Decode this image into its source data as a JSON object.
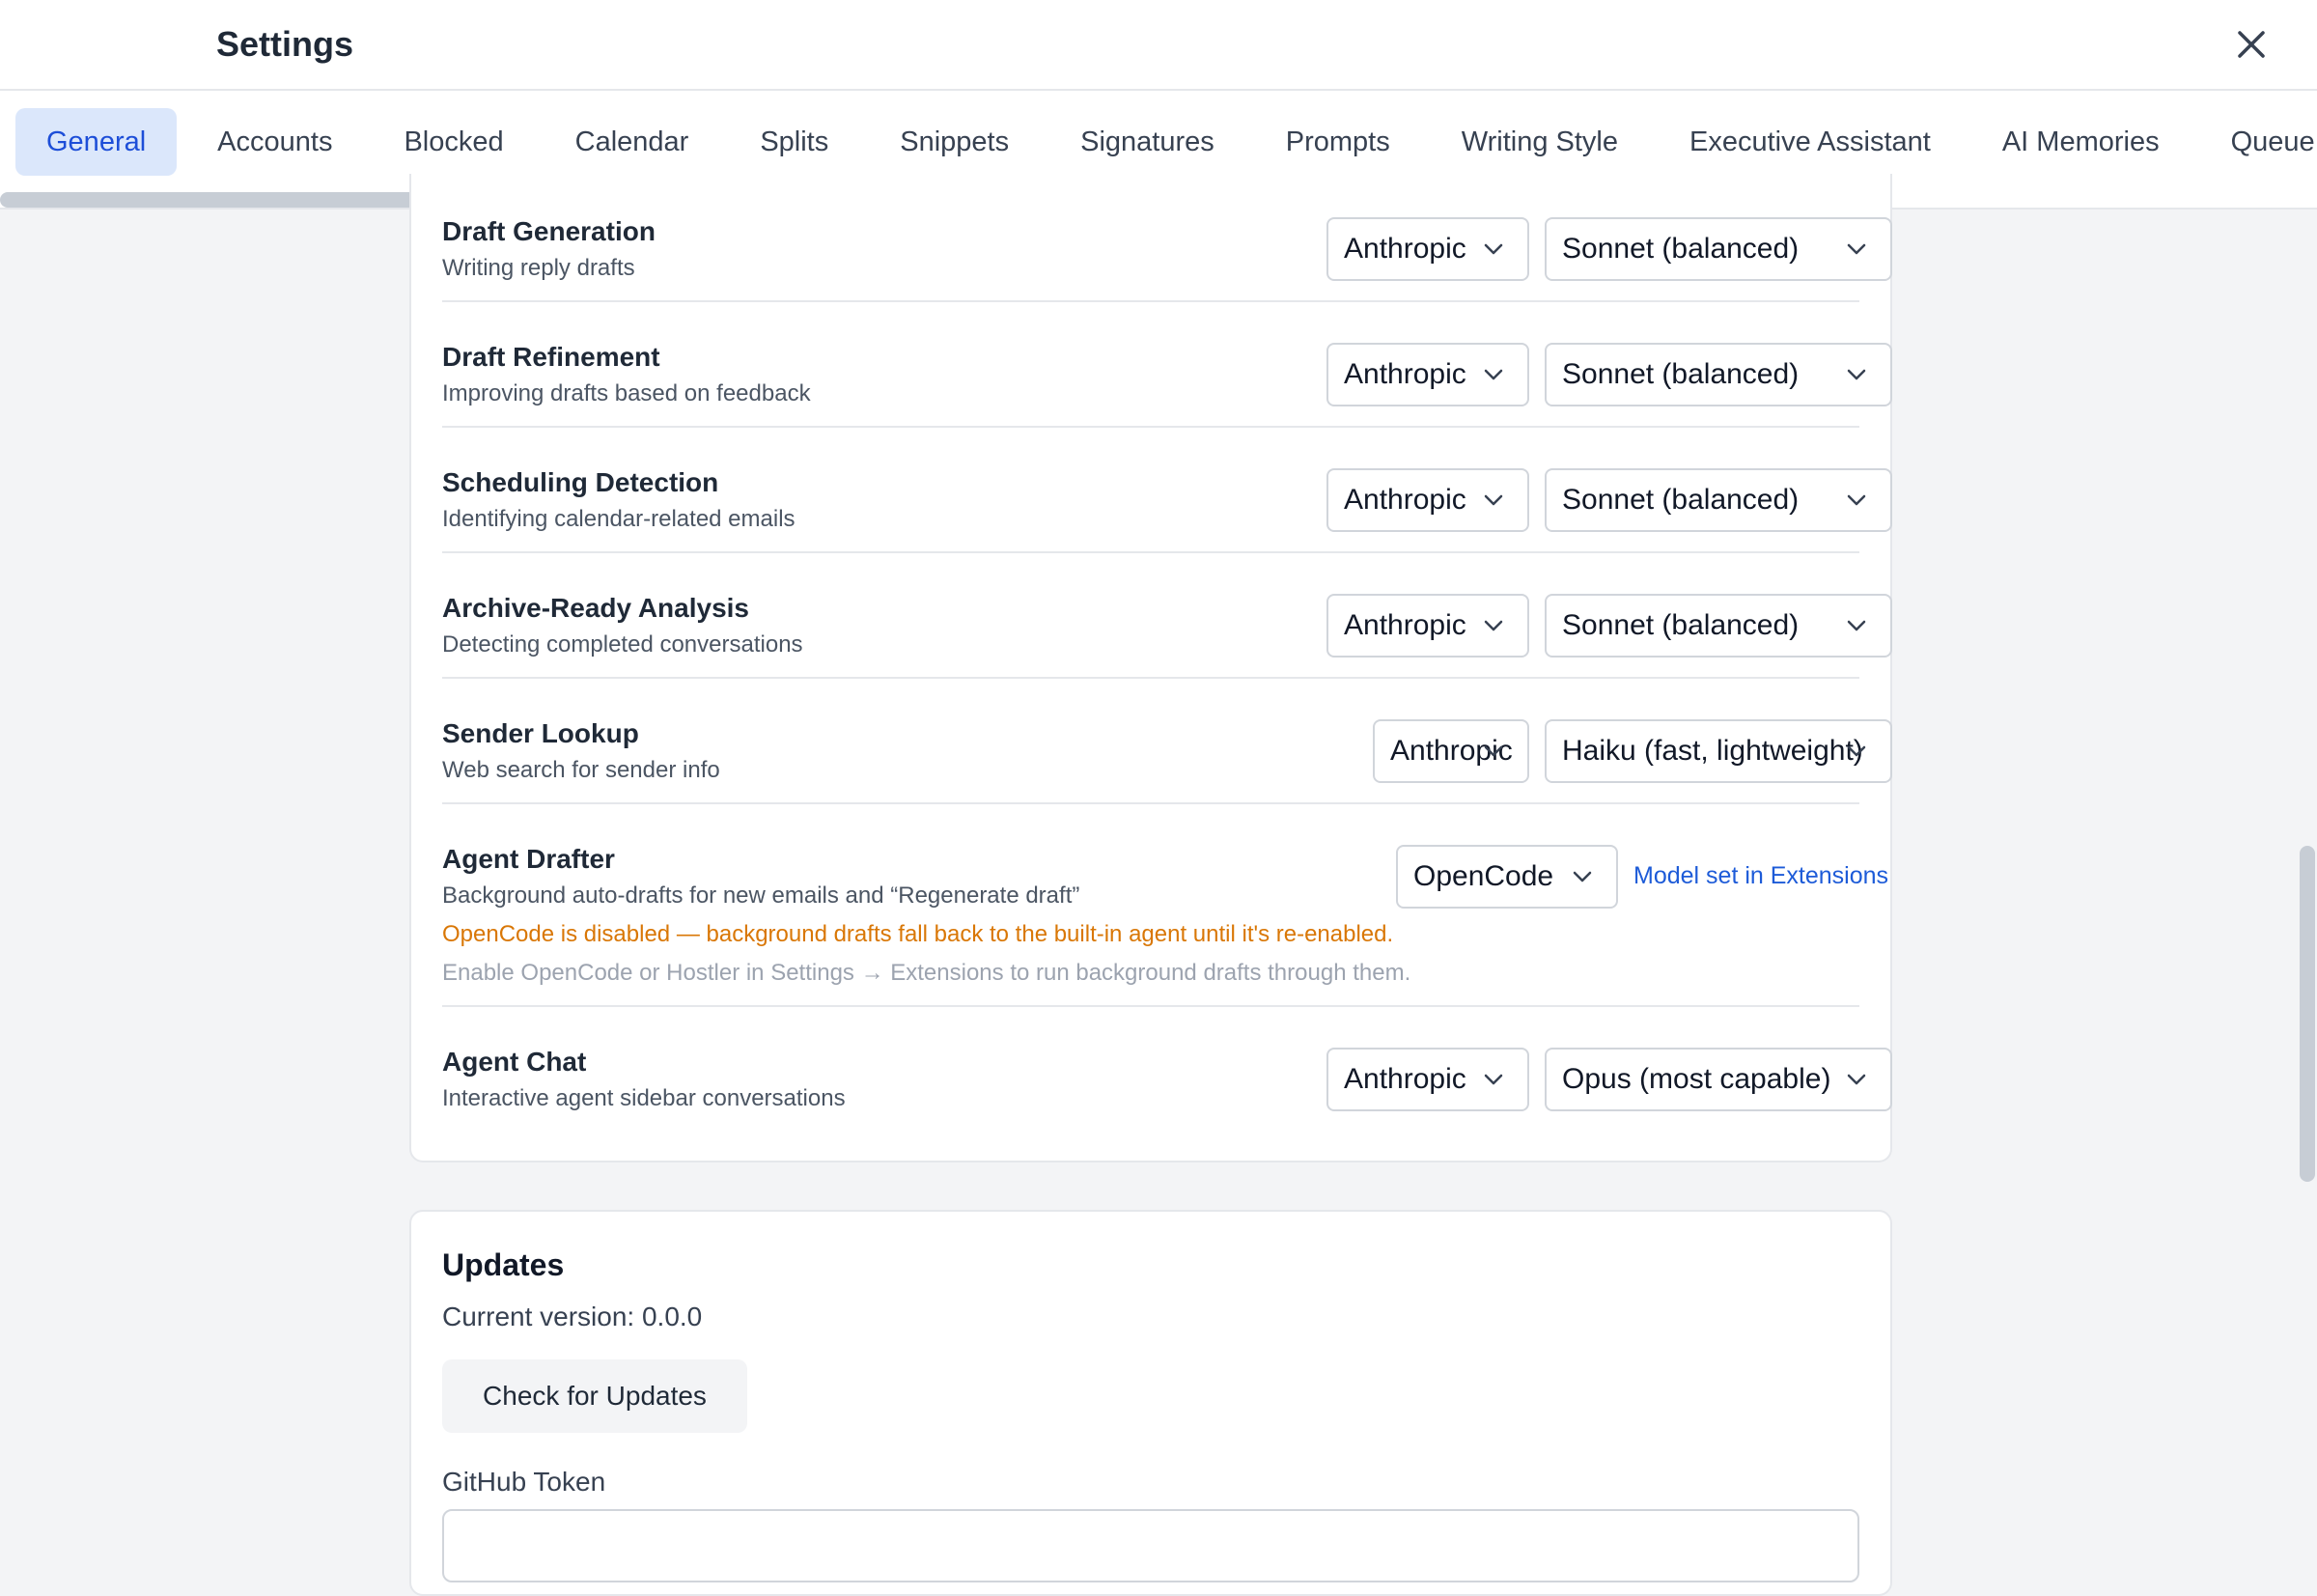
{
  "header": {
    "title": "Settings"
  },
  "tabs": [
    {
      "label": "General",
      "active": true
    },
    {
      "label": "Accounts"
    },
    {
      "label": "Blocked"
    },
    {
      "label": "Calendar"
    },
    {
      "label": "Splits"
    },
    {
      "label": "Snippets"
    },
    {
      "label": "Signatures"
    },
    {
      "label": "Prompts"
    },
    {
      "label": "Writing Style"
    },
    {
      "label": "Executive Assistant"
    },
    {
      "label": "AI Memories"
    },
    {
      "label": "Queue"
    }
  ],
  "ai_models": {
    "rows": [
      {
        "title": "Draft Generation",
        "description": "Writing reply drafts",
        "provider": "Anthropic",
        "model": "Sonnet (balanced)"
      },
      {
        "title": "Draft Refinement",
        "description": "Improving drafts based on feedback",
        "provider": "Anthropic",
        "model": "Sonnet (balanced)"
      },
      {
        "title": "Scheduling Detection",
        "description": "Identifying calendar-related emails",
        "provider": "Anthropic",
        "model": "Sonnet (balanced)"
      },
      {
        "title": "Archive-Ready Analysis",
        "description": "Detecting completed conversations",
        "provider": "Anthropic",
        "model": "Sonnet (balanced)"
      },
      {
        "title": "Sender Lookup",
        "description": "Web search for sender info",
        "provider": "Anthropic",
        "model": "Haiku (fast, lightweight)"
      }
    ],
    "agent_drafter": {
      "title": "Agent Drafter",
      "description": "Background auto-drafts for new emails and “Regenerate draft”",
      "provider": "OpenCode",
      "link": "Model set in Extensions",
      "warning": "OpenCode is disabled — background drafts fall back to the built-in agent until it's re-enabled.",
      "hint": "Enable OpenCode or Hostler in Settings → Extensions to run background drafts through them."
    },
    "agent_chat": {
      "title": "Agent Chat",
      "description": "Interactive agent sidebar conversations",
      "provider": "Anthropic",
      "model": "Opus (most capable)"
    }
  },
  "updates": {
    "title": "Updates",
    "current_version": "Current version: 0.0.0",
    "check_button": "Check for Updates",
    "github_token_label": "GitHub Token",
    "github_token_value": ""
  },
  "icons": {
    "close": "close-icon",
    "chevron": "chevron-down-icon"
  },
  "colors": {
    "accent": "#1d4ed8",
    "active_tab_bg": "#dbe7fb",
    "warning": "#d97706",
    "link": "#1d5bd8"
  }
}
